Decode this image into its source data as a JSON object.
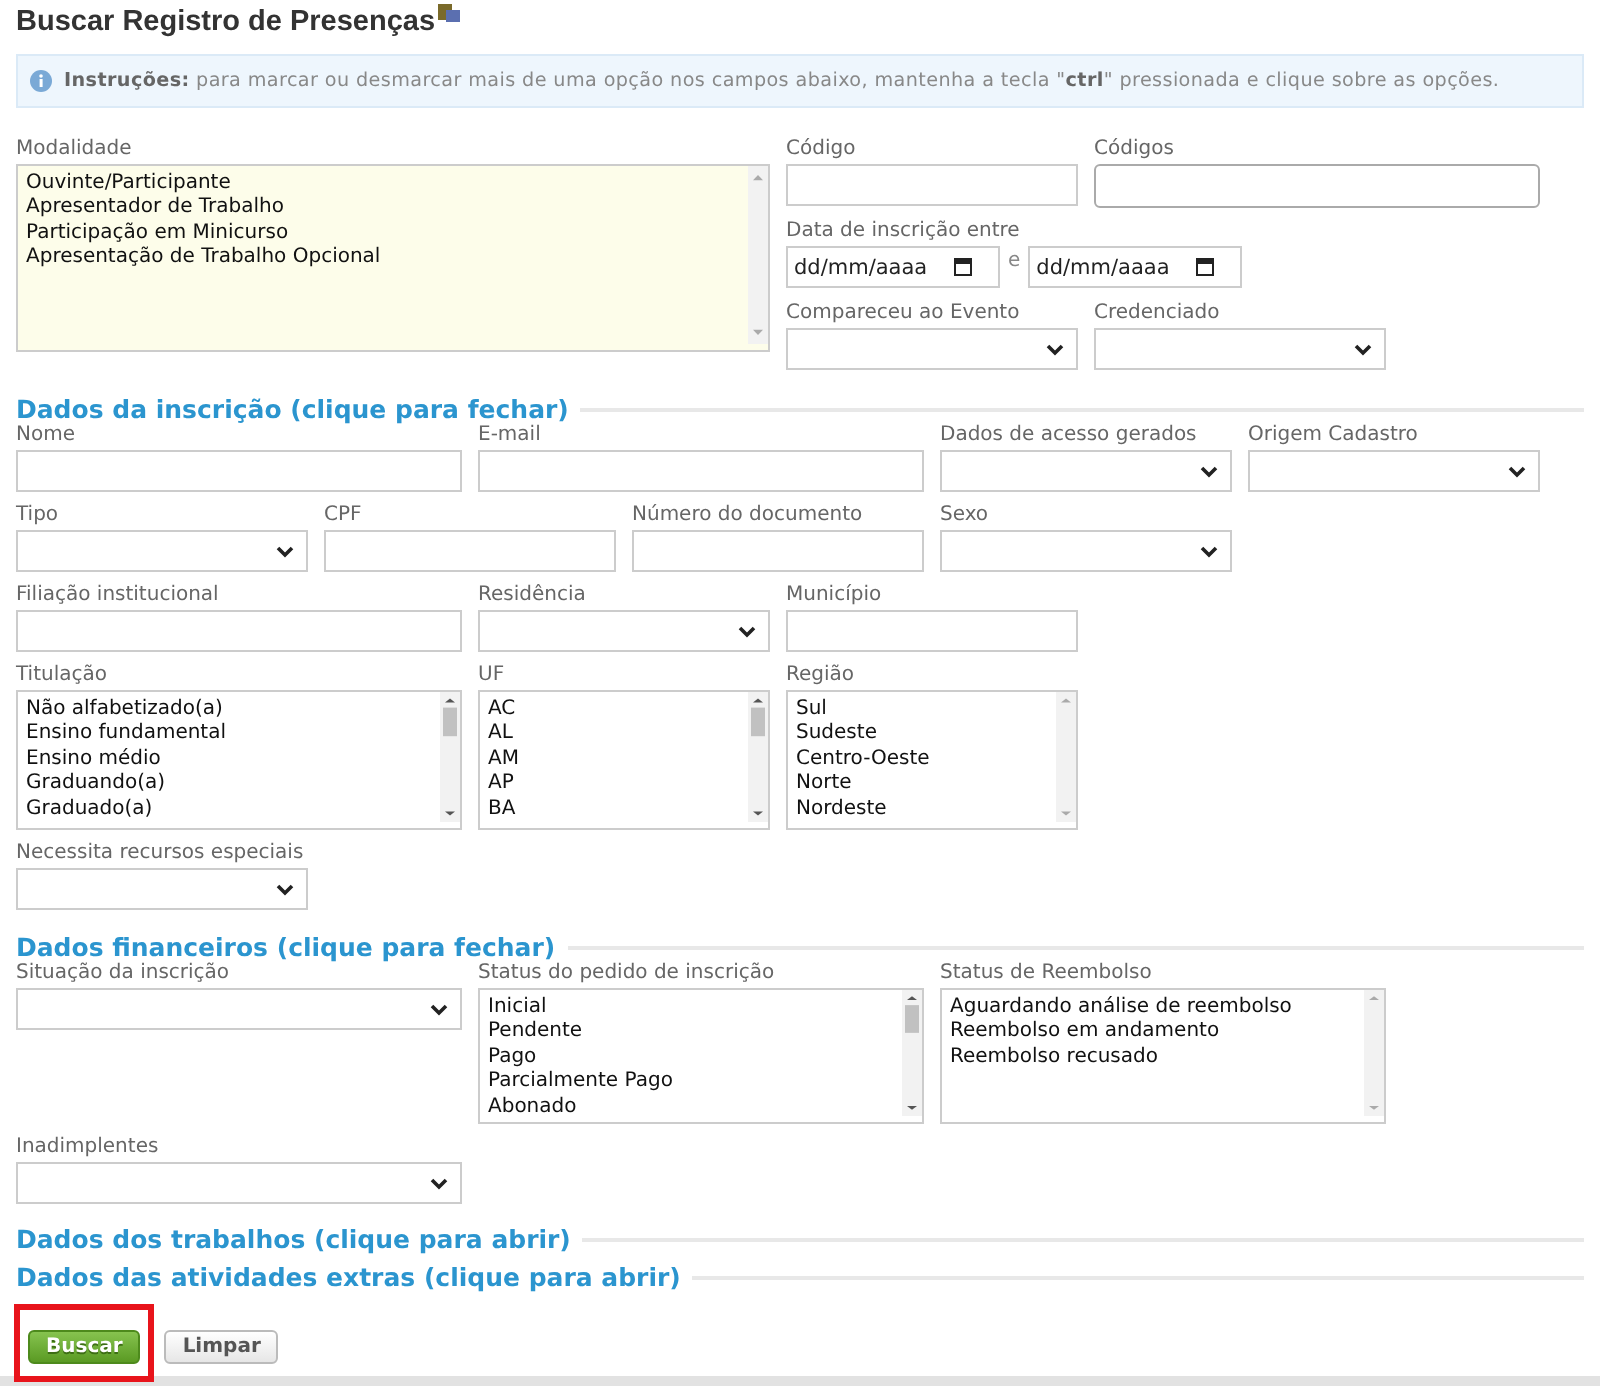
{
  "title": "Buscar Registro de Presenças",
  "info": {
    "text": "**Instruções:** para marcar ou desmarcar mais de uma opção nos campos abaixo, mantenha a tecla \"**ctrl**\" pressionada e clique sobre as opções."
  },
  "top_fields": [
    {
      "kind": "listbox",
      "label": "Modalidade",
      "scrollable": false,
      "options": [
        "Ouvinte/Participante",
        "Apresentador de Trabalho",
        "Participação em Minicurso",
        "Apresentação de Trabalho Opcional"
      ]
    },
    {
      "kind": "text",
      "label": "Código"
    },
    {
      "kind": "textarea",
      "label": "Códigos"
    },
    {
      "kind": "date_range",
      "label": "Data de inscrição entre",
      "from_placeholder": "dd/mm/aaaa",
      "separator": "e",
      "to_placeholder": "dd/mm/aaaa"
    },
    {
      "kind": "select",
      "label": "Compareceu ao Evento"
    },
    {
      "kind": "select",
      "label": "Credenciado"
    }
  ],
  "sections": [
    {
      "title": "Dados da inscrição (clique para fechar)",
      "expanded": true,
      "field_groups": [
        [
          {
            "kind": "text",
            "label": "Nome"
          },
          {
            "kind": "text",
            "label": "E-mail"
          },
          {
            "kind": "select",
            "label": "Dados de acesso gerados"
          },
          {
            "kind": "select",
            "label": "Origem Cadastro"
          }
        ],
        [
          {
            "kind": "select",
            "label": "Tipo"
          },
          {
            "kind": "text",
            "label": "CPF"
          },
          {
            "kind": "text",
            "label": "Número do documento"
          },
          {
            "kind": "select",
            "label": "Sexo"
          }
        ],
        [
          {
            "kind": "text",
            "label": "Filiação institucional"
          },
          {
            "kind": "select",
            "label": "Residência"
          },
          {
            "kind": "text",
            "label": "Município"
          }
        ],
        [
          {
            "kind": "listbox",
            "label": "Titulação",
            "scrollable": true,
            "options": [
              "Não alfabetizado(a)",
              "Ensino fundamental",
              "Ensino médio",
              "Graduando(a)",
              "Graduado(a)"
            ]
          },
          {
            "kind": "listbox",
            "label": "UF",
            "scrollable": true,
            "options": [
              "AC",
              "AL",
              "AM",
              "AP",
              "BA"
            ]
          },
          {
            "kind": "listbox",
            "label": "Região",
            "scrollable": false,
            "options": [
              "Sul",
              "Sudeste",
              "Centro-Oeste",
              "Norte",
              "Nordeste"
            ]
          }
        ],
        [
          {
            "kind": "select",
            "label": "Necessita recursos especiais"
          }
        ]
      ]
    },
    {
      "title": "Dados financeiros (clique para fechar)",
      "expanded": true,
      "field_groups": [
        [
          {
            "kind": "select",
            "label": "Situação da inscrição"
          },
          {
            "kind": "listbox",
            "label": "Status do pedido de inscrição",
            "scrollable": true,
            "options": [
              "Inicial",
              "Pendente",
              "Pago",
              "Parcialmente Pago",
              "Abonado"
            ]
          },
          {
            "kind": "listbox",
            "label": "Status de Reembolso",
            "scrollable": false,
            "options": [
              "Aguardando análise de reembolso",
              "Reembolso em andamento",
              "Reembolso recusado"
            ]
          }
        ],
        [
          {
            "kind": "select",
            "label": "Inadimplentes"
          }
        ]
      ]
    },
    {
      "title": "Dados dos trabalhos (clique para abrir)"
    },
    {
      "title": "Dados das atividades extras (clique para abrir)"
    }
  ],
  "buttons": [
    {
      "label": "Buscar",
      "kind": "primary",
      "highlighted": true
    },
    {
      "label": "Limpar",
      "kind": "secondary",
      "highlighted": false
    }
  ]
}
